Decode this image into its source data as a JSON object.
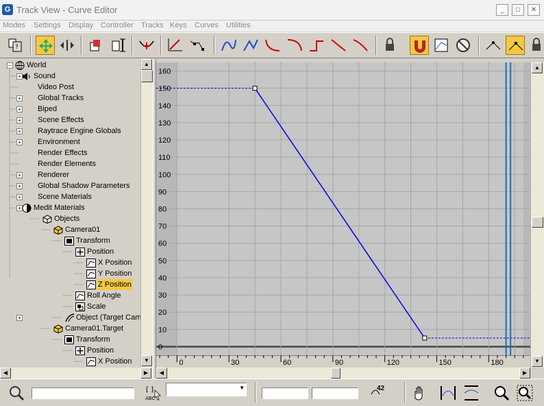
{
  "window": {
    "title": "Track View - Curve Editor",
    "app_icon": "G",
    "minimize": "_",
    "maximize": "□",
    "close": "✕"
  },
  "menu": [
    {
      "label": "Modes"
    },
    {
      "label": "Settings"
    },
    {
      "label": "Display"
    },
    {
      "label": "Controller"
    },
    {
      "label": "Tracks"
    },
    {
      "label": "Keys"
    },
    {
      "label": "Curves"
    },
    {
      "label": "Utilities"
    }
  ],
  "toolbar": {
    "buttons": [
      {
        "name": "filters-icon"
      },
      {
        "name": "move-keys-icon",
        "active": true
      },
      {
        "name": "slide-keys-icon"
      },
      {
        "name": "scale-keys-icon"
      },
      {
        "name": "scale-values-icon"
      },
      {
        "name": "add-keys-icon"
      },
      {
        "name": "draw-curves-icon"
      },
      {
        "name": "reduce-keys-icon"
      },
      {
        "name": "tangent-auto-icon"
      },
      {
        "name": "tangent-custom-icon"
      },
      {
        "name": "tangent-fast-icon"
      },
      {
        "name": "tangent-slow-icon"
      },
      {
        "name": "tangent-step-icon"
      },
      {
        "name": "tangent-linear-icon"
      },
      {
        "name": "tangent-smooth-icon"
      },
      {
        "name": "lock-tangents-icon"
      },
      {
        "name": "snap-frames-icon",
        "active": true
      },
      {
        "name": "parameter-curve-oor-icon"
      },
      {
        "name": "show-keyable-icon"
      },
      {
        "name": "show-all-tangents-icon"
      },
      {
        "name": "show-tangents-icon",
        "active": true
      },
      {
        "name": "lock-selection-icon"
      }
    ]
  },
  "tree": {
    "rows": [
      {
        "label": "World",
        "icon": "globe-icon",
        "indent": 0,
        "expander": "-"
      },
      {
        "label": "Sound",
        "icon": "speaker-icon",
        "indent": 1,
        "expander": "+"
      },
      {
        "label": "Video Post",
        "icon": "",
        "indent": 1,
        "expander": ""
      },
      {
        "label": "Global Tracks",
        "icon": "",
        "indent": 1,
        "expander": "+"
      },
      {
        "label": "Biped",
        "icon": "",
        "indent": 1,
        "expander": "+"
      },
      {
        "label": "Scene Effects",
        "icon": "",
        "indent": 1,
        "expander": "+"
      },
      {
        "label": "Raytrace Engine Globals",
        "icon": "",
        "indent": 1,
        "expander": "+"
      },
      {
        "label": "Environment",
        "icon": "",
        "indent": 1,
        "expander": "+"
      },
      {
        "label": "Render Effects",
        "icon": "",
        "indent": 1,
        "expander": ""
      },
      {
        "label": "Render Elements",
        "icon": "",
        "indent": 1,
        "expander": ""
      },
      {
        "label": "Renderer",
        "icon": "",
        "indent": 1,
        "expander": "+"
      },
      {
        "label": "Global Shadow Parameters",
        "icon": "",
        "indent": 1,
        "expander": "+"
      },
      {
        "label": "Scene Materials",
        "icon": "",
        "indent": 1,
        "expander": "+"
      },
      {
        "label": "Medit Materials",
        "icon": "sphere-icon",
        "indent": 1,
        "expander": "+"
      },
      {
        "label": "Objects",
        "icon": "cube-icon",
        "indent": 2,
        "expander": ""
      },
      {
        "label": "Camera01",
        "icon": "cube-yellow-icon",
        "indent": 3,
        "expander": ""
      },
      {
        "label": "Transform",
        "icon": "transform-icon",
        "indent": 4,
        "expander": ""
      },
      {
        "label": "Position",
        "icon": "position-icon",
        "indent": 5,
        "expander": ""
      },
      {
        "label": "X Position",
        "icon": "track-icon",
        "indent": 6,
        "expander": ""
      },
      {
        "label": "Y Position",
        "icon": "track-icon",
        "indent": 6,
        "expander": ""
      },
      {
        "label": "Z Position",
        "icon": "track-icon",
        "indent": 6,
        "expander": "",
        "selected": true
      },
      {
        "label": "Roll Angle",
        "icon": "track-icon",
        "indent": 5,
        "expander": ""
      },
      {
        "label": "Scale",
        "icon": "scale-track-icon",
        "indent": 5,
        "expander": ""
      },
      {
        "label": "Object (Target Camer",
        "icon": "camera-object-icon",
        "indent": 4,
        "expander": "+"
      },
      {
        "label": "Camera01.Target",
        "icon": "cube-yellow-icon",
        "indent": 3,
        "expander": ""
      },
      {
        "label": "Transform",
        "icon": "transform-icon",
        "indent": 4,
        "expander": ""
      },
      {
        "label": "Position",
        "icon": "position-icon",
        "indent": 5,
        "expander": ""
      },
      {
        "label": "X Position",
        "icon": "track-icon",
        "indent": 6,
        "expander": ""
      }
    ]
  },
  "graph": {
    "y_ticks": [
      "160",
      "150",
      "140",
      "130",
      "120",
      "110",
      "100",
      "90",
      "80",
      "70",
      "60",
      "50",
      "40",
      "30",
      "20",
      "10",
      "0"
    ],
    "x_ticks": [
      "0",
      "30",
      "60",
      "90",
      "120",
      "150",
      "180"
    ],
    "curve_color": "#0000e0",
    "keys": [
      {
        "frame": 45,
        "value": 150
      },
      {
        "frame": 143,
        "value": 5
      }
    ],
    "time_slider_frame": 190,
    "timeline_end_frame": 191,
    "active_range_end_frame": 200,
    "x_range": [
      -12,
      204
    ],
    "y_range": [
      -5,
      165
    ]
  },
  "chart_data": {
    "type": "line",
    "series": [
      {
        "values": [
          150,
          150,
          5,
          5
        ]
      }
    ],
    "x": [
      -12,
      45,
      143,
      204
    ],
    "xlim": [
      -12,
      204
    ],
    "ylim": [
      -5,
      165
    ],
    "grid": true,
    "x_tick_labels": [
      "0",
      "30",
      "60",
      "90",
      "120",
      "150",
      "180"
    ],
    "y_tick_labels": [
      "0",
      "10",
      "20",
      "30",
      "40",
      "50",
      "60",
      "70",
      "80",
      "90",
      "100",
      "110",
      "120",
      "130",
      "140",
      "150",
      "160"
    ]
  },
  "status": {
    "value_readout": "42"
  }
}
